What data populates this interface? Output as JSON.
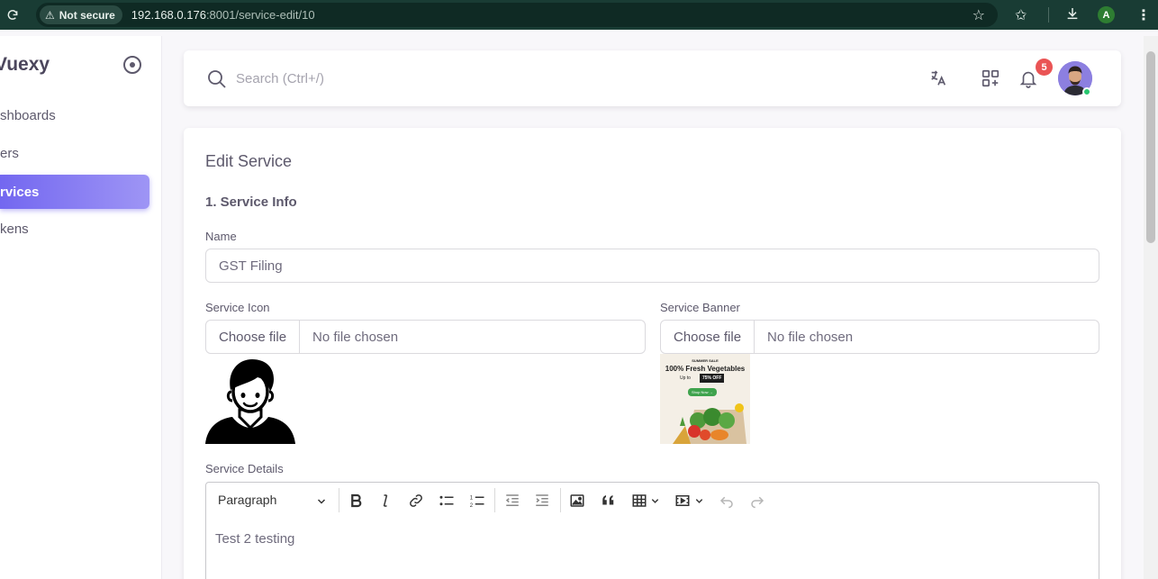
{
  "browser": {
    "security_label": "Not secure",
    "url_host": "192.168.0.176",
    "url_path": ":8001/service-edit/10",
    "profile_initial": "A"
  },
  "sidebar": {
    "brand": "Vuexy",
    "items": [
      {
        "label": "Dashboards",
        "shown": "shboards",
        "active": false
      },
      {
        "label": "Users",
        "shown": "ers",
        "active": false
      },
      {
        "label": "Services",
        "shown": "rvices",
        "active": true
      },
      {
        "label": "Tokens",
        "shown": "kens",
        "active": false
      }
    ]
  },
  "topnav": {
    "search_placeholder": "Search (Ctrl+/)",
    "notification_count": "5",
    "icons": [
      "translate-icon",
      "shortcuts-icon",
      "bell-icon"
    ]
  },
  "form": {
    "title": "Edit Service",
    "section": "1. Service Info",
    "name_label": "Name",
    "name_value": "GST Filing",
    "icon_label": "Service Icon",
    "banner_label": "Service Banner",
    "choose_file": "Choose file",
    "no_file": "No file chosen",
    "details_label": "Service Details",
    "banner_image_text": {
      "tag": "SUMMER SALE",
      "headline": "100% Fresh Vegetables",
      "upto": "Up to",
      "discount": "75% OFF",
      "cta": "Shop Now →"
    }
  },
  "editor": {
    "paragraph_label": "Paragraph",
    "content": "Test 2 testing"
  },
  "colors": {
    "primary": "#7367f0",
    "badge": "#ea5455",
    "online": "#28c76f",
    "browser_bar": "#193c34"
  }
}
